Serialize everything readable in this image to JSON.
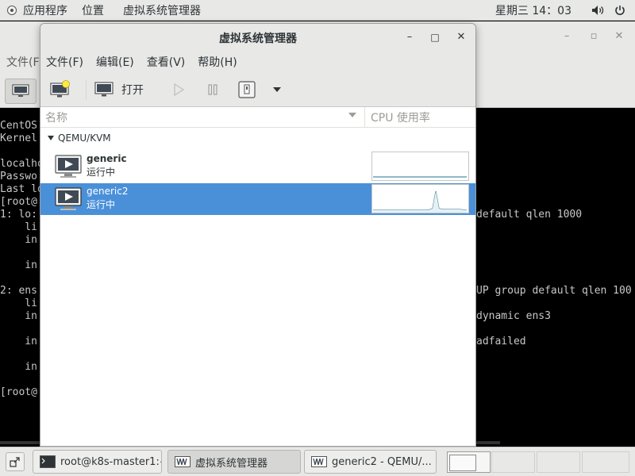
{
  "top_panel": {
    "applications": "应用程序",
    "places": "位置",
    "active_app": "虚拟系统管理器",
    "clock": "星期三 14：03"
  },
  "background_window": {
    "menu_partial": "文件(F",
    "console_lines": [
      "CentOS",
      "Kernel",
      "",
      "localho",
      "Passwo",
      "Last lo",
      "[root@",
      "1: lo:",
      "    li",
      "    in",
      "",
      "    in",
      "",
      "2: ens",
      "    li",
      "    in",
      "",
      "    in",
      "",
      "    in",
      "",
      "[root@"
    ],
    "console_right": [
      "default qlen 1000",
      "UP group default qlen 100",
      "dynamic ens3",
      "adfailed"
    ]
  },
  "window": {
    "title": "虚拟系统管理器",
    "minimize": "–",
    "maximize": "□",
    "close": "✕"
  },
  "menu": [
    "文件(F)",
    "编辑(E)",
    "查看(V)",
    "帮助(H)"
  ],
  "toolbar": {
    "open_label": "打开"
  },
  "list": {
    "col_name": "名称",
    "col_cpu": "CPU 使用率",
    "group": "QEMU/KVM",
    "vms": [
      {
        "name": "generic",
        "status": "运行中",
        "selected": false
      },
      {
        "name": "generic2",
        "status": "运行中",
        "selected": true
      }
    ]
  },
  "taskbar": {
    "tasks": [
      "root@k8s-master1:~",
      "虚拟系统管理器",
      "generic2 - QEMU/..."
    ],
    "active_index": 1,
    "workspaces": 4,
    "active_workspace": 0
  },
  "colors": {
    "selection": "#4a90d9",
    "panel": "#e8e8e7"
  }
}
